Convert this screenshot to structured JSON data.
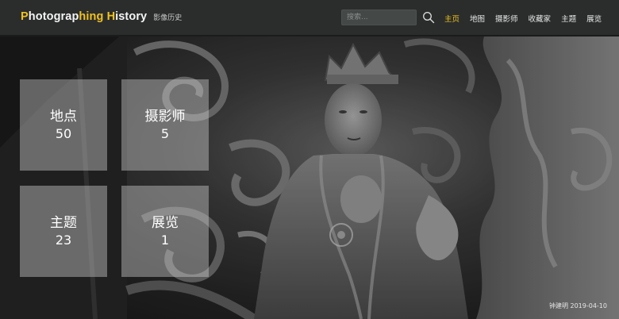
{
  "brand": {
    "title_parts": [
      "P",
      "hotograp",
      "hing",
      " ",
      "H",
      "istory"
    ],
    "subtitle": "影像历史"
  },
  "search": {
    "placeholder": "搜索..."
  },
  "nav": {
    "items": [
      {
        "label": "主页",
        "active": true
      },
      {
        "label": "地图",
        "active": false
      },
      {
        "label": "摄影师",
        "active": false
      },
      {
        "label": "收藏家",
        "active": false
      },
      {
        "label": "主题",
        "active": false
      },
      {
        "label": "展览",
        "active": false
      }
    ]
  },
  "tiles": [
    {
      "label": "地点",
      "count": "50"
    },
    {
      "label": "摄影师",
      "count": "5"
    },
    {
      "label": "主题",
      "count": "23"
    },
    {
      "label": "展览",
      "count": "1"
    }
  ],
  "hero": {
    "photo_credit": "钟建明 2019-04-10"
  },
  "colors": {
    "accent": "#f0c21b",
    "header_bg": "#2b2d2d",
    "tile_bg": "rgba(210,210,210,0.42)"
  }
}
